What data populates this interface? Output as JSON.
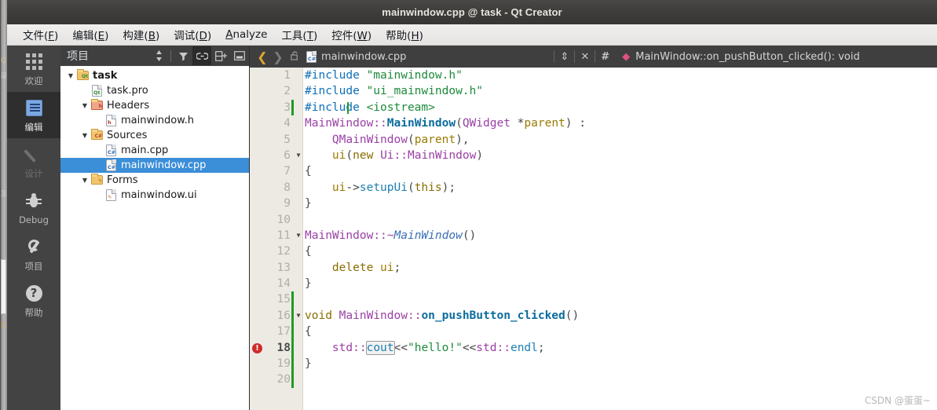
{
  "window": {
    "title": "mainwindow.cpp @ task - Qt Creator"
  },
  "menubar": {
    "items": [
      {
        "pre": "文件(",
        "key": "F",
        "post": ")"
      },
      {
        "pre": "编辑(",
        "key": "E",
        "post": ")"
      },
      {
        "pre": "构建(",
        "key": "B",
        "post": ")"
      },
      {
        "pre": "调试(",
        "key": "D",
        "post": ")"
      },
      {
        "pre": "",
        "key": "A",
        "post": "nalyze"
      },
      {
        "pre": "工具(",
        "key": "T",
        "post": ")"
      },
      {
        "pre": "控件(",
        "key": "W",
        "post": ")"
      },
      {
        "pre": "帮助(",
        "key": "H",
        "post": ")"
      }
    ]
  },
  "modebar": {
    "items": [
      {
        "label": "欢迎",
        "icon": "grid-icon",
        "state": "normal"
      },
      {
        "label": "编辑",
        "icon": "edit-document-icon",
        "state": "selected"
      },
      {
        "label": "设计",
        "icon": "pencil-icon",
        "state": "disabled"
      },
      {
        "label": "Debug",
        "icon": "bug-icon",
        "state": "normal"
      },
      {
        "label": "项目",
        "icon": "wrench-icon",
        "state": "normal"
      },
      {
        "label": "帮助",
        "icon": "question-mark-icon",
        "state": "normal"
      }
    ]
  },
  "sidepanel": {
    "title": "项目",
    "tools": [
      {
        "name": "sync-selection-icon",
        "glyph": "⇕",
        "active": false
      },
      {
        "name": "filter-icon",
        "glyph": "▼",
        "active": false
      },
      {
        "name": "link-icon",
        "glyph": "⛓",
        "active": true
      },
      {
        "name": "split-add-icon",
        "glyph": "⊟",
        "active": false
      },
      {
        "name": "close-panel-icon",
        "glyph": "⊡",
        "active": false
      }
    ],
    "tree": [
      {
        "label": "task",
        "indent": 0,
        "twist": "▼",
        "icon": "qt-project-folder",
        "bold": true,
        "selected": false
      },
      {
        "label": "task.pro",
        "indent": 1,
        "twist": "",
        "icon": "qt-pro-file",
        "bold": false,
        "selected": false
      },
      {
        "label": "Headers",
        "indent": 1,
        "twist": "▼",
        "icon": "headers-folder",
        "bold": false,
        "selected": false
      },
      {
        "label": "mainwindow.h",
        "indent": 2,
        "twist": "",
        "icon": "header-file",
        "bold": false,
        "selected": false
      },
      {
        "label": "Sources",
        "indent": 1,
        "twist": "▼",
        "icon": "sources-folder",
        "bold": false,
        "selected": false
      },
      {
        "label": "main.cpp",
        "indent": 2,
        "twist": "",
        "icon": "cpp-file",
        "bold": false,
        "selected": false
      },
      {
        "label": "mainwindow.cpp",
        "indent": 2,
        "twist": "",
        "icon": "cpp-file",
        "bold": false,
        "selected": true
      },
      {
        "label": "Forms",
        "indent": 1,
        "twist": "▼",
        "icon": "forms-folder",
        "bold": false,
        "selected": false
      },
      {
        "label": "mainwindow.ui",
        "indent": 2,
        "twist": "",
        "icon": "ui-file",
        "bold": false,
        "selected": false
      }
    ]
  },
  "editor": {
    "toolbar": {
      "back_arrow": "❮",
      "forward_arrow": "❯",
      "lock_icon": "🔓",
      "filename": "mainwindow.cpp",
      "file_dropdown": "⇕",
      "close_icon": "✕",
      "hash_icon": "#",
      "symbol_marker": "◆",
      "symbol": "MainWindow::on_pushButton_clicked(): void"
    },
    "lines": [
      {
        "n": "1",
        "fold": "",
        "changed": false,
        "error": false,
        "cursor": false
      },
      {
        "n": "2",
        "fold": "",
        "changed": false,
        "error": false,
        "cursor": false
      },
      {
        "n": "3",
        "fold": "",
        "changed": true,
        "error": false,
        "cursor": true
      },
      {
        "n": "4",
        "fold": "",
        "changed": false,
        "error": false,
        "cursor": false
      },
      {
        "n": "5",
        "fold": "",
        "changed": false,
        "error": false,
        "cursor": false
      },
      {
        "n": "6",
        "fold": "▼",
        "changed": false,
        "error": false,
        "cursor": false
      },
      {
        "n": "7",
        "fold": "",
        "changed": false,
        "error": false,
        "cursor": false
      },
      {
        "n": "8",
        "fold": "",
        "changed": false,
        "error": false,
        "cursor": false
      },
      {
        "n": "9",
        "fold": "",
        "changed": false,
        "error": false,
        "cursor": false
      },
      {
        "n": "10",
        "fold": "",
        "changed": false,
        "error": false,
        "cursor": false
      },
      {
        "n": "11",
        "fold": "▼",
        "changed": false,
        "error": false,
        "cursor": false
      },
      {
        "n": "12",
        "fold": "",
        "changed": false,
        "error": false,
        "cursor": false
      },
      {
        "n": "13",
        "fold": "",
        "changed": false,
        "error": false,
        "cursor": false
      },
      {
        "n": "14",
        "fold": "",
        "changed": false,
        "error": false,
        "cursor": false
      },
      {
        "n": "15",
        "fold": "",
        "changed": true,
        "error": false,
        "cursor": false
      },
      {
        "n": "16",
        "fold": "▼",
        "changed": true,
        "error": false,
        "cursor": false
      },
      {
        "n": "17",
        "fold": "",
        "changed": true,
        "error": false,
        "cursor": false
      },
      {
        "n": "18",
        "fold": "",
        "changed": true,
        "error": true,
        "cursor": false,
        "current": true
      },
      {
        "n": "19",
        "fold": "",
        "changed": true,
        "error": false,
        "cursor": false
      },
      {
        "n": "20",
        "fold": "",
        "changed": true,
        "error": false,
        "cursor": false
      }
    ],
    "code_text": [
      "#include \"mainwindow.h\"",
      "#include \"ui_mainwindow.h\"",
      "#include <iostream>",
      "MainWindow::MainWindow(QWidget *parent) :",
      "    QMainWindow(parent),",
      "    ui(new Ui::MainWindow)",
      "{",
      "    ui->setupUi(this);",
      "}",
      "",
      "MainWindow::~MainWindow()",
      "{",
      "    delete ui;",
      "}",
      "",
      "void MainWindow::on_pushButton_clicked()",
      "{",
      "    std::cout<<\"hello!\"<<std::endl;",
      "}",
      ""
    ],
    "error_glyph": "!"
  },
  "watermark": "CSDN @蛋蛋~"
}
